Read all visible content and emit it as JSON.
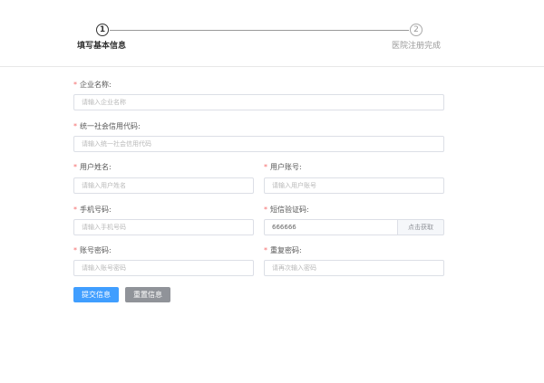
{
  "steps": [
    {
      "number": "1",
      "title": "填写基本信息",
      "state": "active"
    },
    {
      "number": "2",
      "title": "医院注册完成",
      "state": "inactive"
    }
  ],
  "form": {
    "required_mark": "*",
    "company_name": {
      "label": "企业名称:",
      "placeholder": "请输入企业名称",
      "value": ""
    },
    "credit_code": {
      "label": "统一社会信用代码:",
      "placeholder": "请输入统一社会信用代码",
      "value": ""
    },
    "user_name": {
      "label": "用户姓名:",
      "placeholder": "请输入用户姓名",
      "value": ""
    },
    "user_account": {
      "label": "用户账号:",
      "placeholder": "请输入用户账号",
      "value": ""
    },
    "phone": {
      "label": "手机号码:",
      "placeholder": "请输入手机号码",
      "value": ""
    },
    "sms_code": {
      "label": "短信验证码:",
      "placeholder": "",
      "value": "666666",
      "button_label": "点击获取"
    },
    "password": {
      "label": "账号密码:",
      "placeholder": "请输入账号密码",
      "value": ""
    },
    "confirm_password": {
      "label": "重复密码:",
      "placeholder": "请再次输入密码",
      "value": ""
    }
  },
  "actions": {
    "submit_label": "提交信息",
    "reset_label": "重置信息"
  },
  "colors": {
    "primary": "#409eff",
    "secondary": "#909399",
    "required": "#f56c6c"
  }
}
